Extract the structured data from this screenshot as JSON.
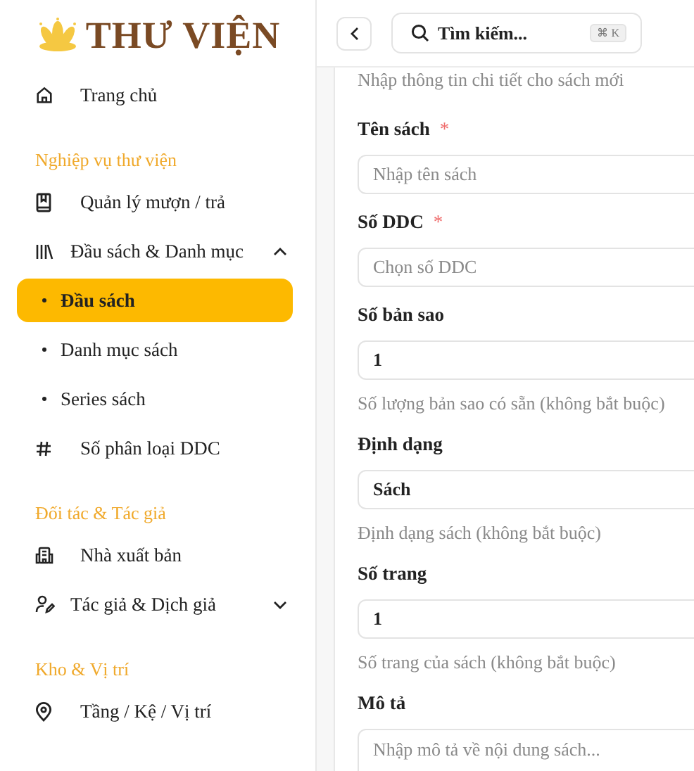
{
  "brand": {
    "title": "THƯ VIỆN"
  },
  "sidebar": {
    "sections": [
      {
        "items": [
          {
            "kind": "link",
            "label": "Trang chủ",
            "selected": false
          }
        ]
      },
      {
        "title": "Nghiệp vụ thư viện",
        "items": [
          {
            "kind": "link",
            "label": "Quản lý mượn / trả",
            "selected": false
          },
          {
            "kind": "group",
            "label": "Đầu sách & Danh mục",
            "expanded": true,
            "children": [
              {
                "label": "Đầu sách",
                "selected": true
              },
              {
                "label": "Danh mục sách",
                "selected": false
              },
              {
                "label": "Series sách",
                "selected": false
              }
            ]
          },
          {
            "kind": "link",
            "label": "Số phân loại DDC",
            "selected": false
          }
        ]
      },
      {
        "title": "Đối tác & Tác giả",
        "items": [
          {
            "kind": "link",
            "label": "Nhà xuất bản",
            "selected": false
          },
          {
            "kind": "group",
            "label": "Tác giả & Dịch giả",
            "expanded": false
          }
        ]
      },
      {
        "title": "Kho & Vị trí",
        "items": [
          {
            "kind": "link",
            "label": "Tầng / Kệ / Vị trí",
            "selected": false
          }
        ]
      }
    ]
  },
  "header": {
    "search": {
      "placeholder": "Tìm kiếm...",
      "shortcut": "⌘ K"
    }
  },
  "form": {
    "subtitle": "Nhập thông tin chi tiết cho sách mới",
    "fields": [
      {
        "kind": "input",
        "label": "Tên sách",
        "required_mark": "*",
        "placeholder": "Nhập tên sách"
      },
      {
        "kind": "select",
        "label": "Số DDC",
        "required_mark": "*",
        "placeholder": "Chọn số DDC"
      },
      {
        "kind": "input",
        "label": "Số bản sao",
        "value": "1",
        "hint": "Số lượng bản sao có sẵn (không bắt buộc)"
      },
      {
        "kind": "select",
        "label": "Định dạng",
        "value": "Sách",
        "hint": "Định dạng sách (không bắt buộc)"
      },
      {
        "kind": "input",
        "label": "Số trang",
        "value": "1",
        "hint": "Số trang của sách (không bắt buộc)"
      },
      {
        "kind": "textarea",
        "label": "Mô tả",
        "placeholder": "Nhập mô tả về nội dung sách..."
      }
    ]
  }
}
